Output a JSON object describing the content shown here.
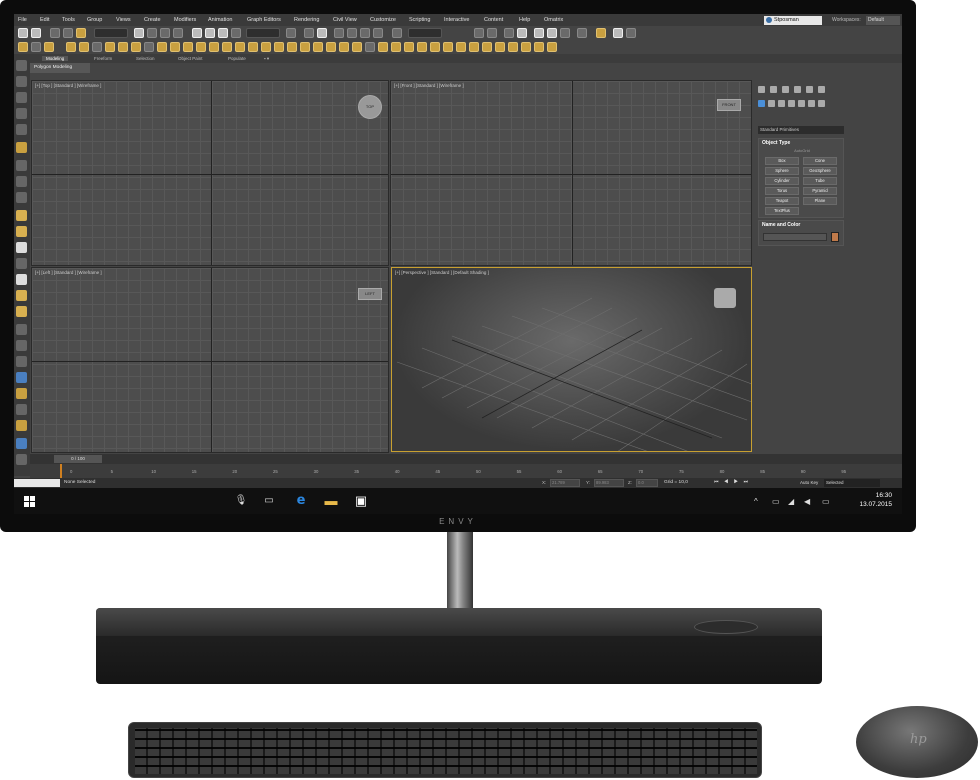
{
  "brand": "ENVY",
  "app": {
    "menu": [
      "File",
      "Edit",
      "Tools",
      "Group",
      "Views",
      "Create",
      "Modifiers",
      "Animation",
      "Graph Editors",
      "Rendering",
      "Civil View",
      "Customize",
      "Scripting",
      "Interactive",
      "Content",
      "Help",
      "Omatrix"
    ],
    "user": "Stposman",
    "workspace_label": "Workspaces:",
    "workspace_value": "Default",
    "ribbon_tabs": [
      "Modeling",
      "Freeform",
      "Selection",
      "Object Paint",
      "Populate"
    ],
    "ribbon_subtab": "Polygon Modeling",
    "viewports": {
      "top": "[+] [Top ] [Standard ] [Wireframe ]",
      "front": "[+] [Front ] [Standard ] [Wireframe ]",
      "left": "[+] [Left ] [Standard ] [Wireframe ]",
      "perspective": "[+] [Perspective ] [Standard ] [Default Shading ]"
    },
    "viewcube": {
      "top": "TOP",
      "front": "FRONT",
      "left": "LEFT"
    },
    "command_panel": {
      "dropdown": "Standard Primitives",
      "object_type_header": "Object Type",
      "autogrid_label": "AutoGrid",
      "buttons": [
        "Box",
        "Cone",
        "Sphere",
        "GeoSphere",
        "Cylinder",
        "Tube",
        "Torus",
        "Pyramid",
        "Teapot",
        "Plane",
        "TextPlus"
      ],
      "name_color_header": "Name and Color",
      "color": "#c07a4a"
    },
    "time_slider": "0 / 100",
    "timeline_ticks": [
      "0",
      "5",
      "10",
      "15",
      "20",
      "25",
      "30",
      "35",
      "40",
      "45",
      "50",
      "55",
      "60",
      "65",
      "70",
      "75",
      "80",
      "85",
      "90",
      "95"
    ],
    "status": {
      "message": "None Selected",
      "x_label": "X:",
      "y_label": "Y:",
      "z_label": "Z:",
      "x_value": "21.789",
      "y_value": "89.983",
      "z_value": "0.0",
      "grid": "Grid = 10,0",
      "auto_key": "Auto Key",
      "selected": "Selected"
    }
  },
  "taskbar": {
    "time": "16:30",
    "date": "13.07.2015"
  }
}
